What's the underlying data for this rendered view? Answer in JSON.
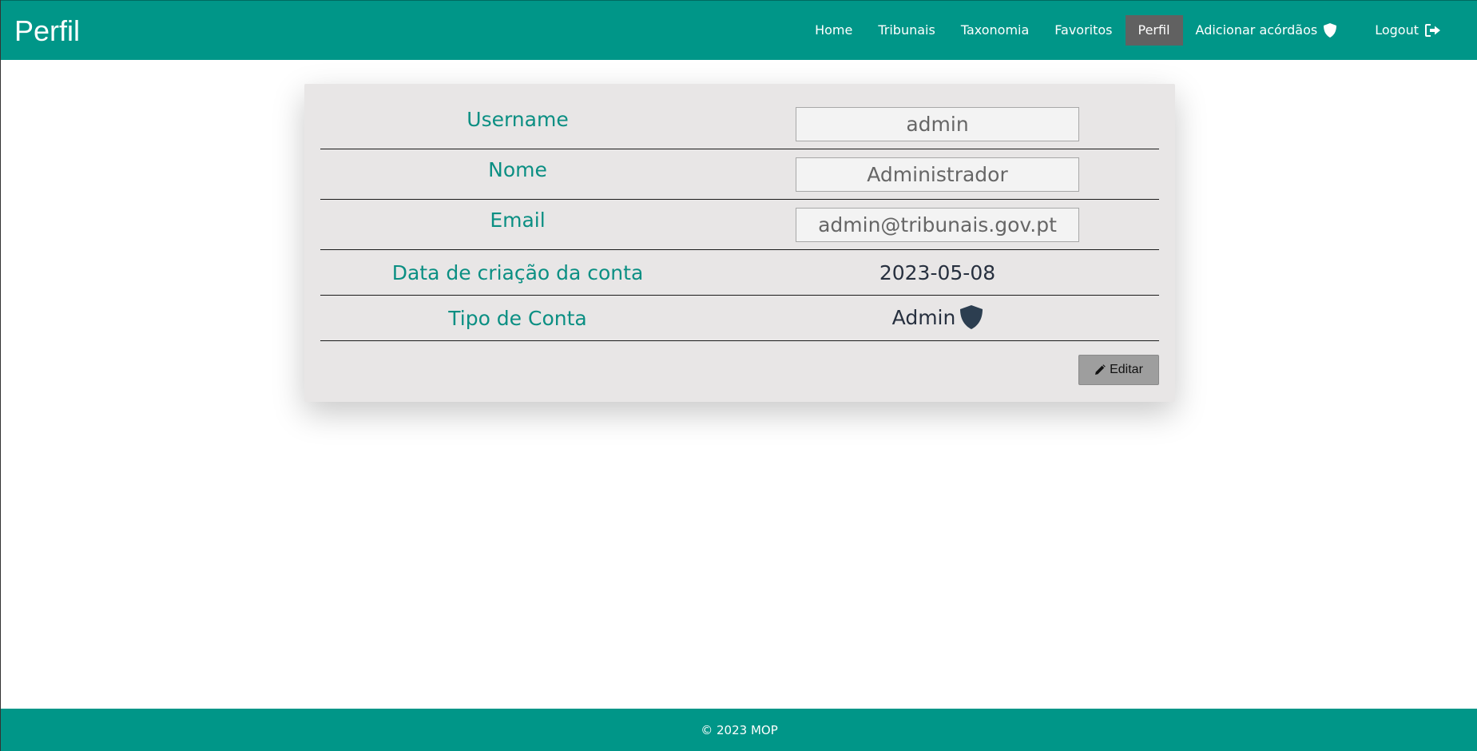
{
  "header": {
    "title": "Perfil",
    "nav": {
      "home": "Home",
      "tribunais": "Tribunais",
      "taxonomia": "Taxonomia",
      "favoritos": "Favoritos",
      "perfil": "Perfil",
      "adicionar": "Adicionar acórdãos",
      "logout": "Logout"
    },
    "icons": {
      "adicionar": "shield-icon",
      "logout": "sign-out-icon"
    }
  },
  "profile": {
    "username_label": "Username",
    "username_value": "admin",
    "nome_label": "Nome",
    "nome_value": "Administrador",
    "email_label": "Email",
    "email_value": "admin@tribunais.gov.pt",
    "data_label": "Data de criação da conta",
    "data_value": "2023-05-08",
    "tipo_label": "Tipo de Conta",
    "tipo_value": "Admin",
    "tipo_icon": "shield-icon",
    "edit_label": "Editar",
    "edit_icon": "pencil-icon"
  },
  "footer": {
    "text": "© 2023 MOP"
  },
  "colors": {
    "primary": "#009688",
    "active_nav": "#616161",
    "label": "#0b8f83",
    "card": "#e8e6e6",
    "button": "#9e9e9e"
  }
}
